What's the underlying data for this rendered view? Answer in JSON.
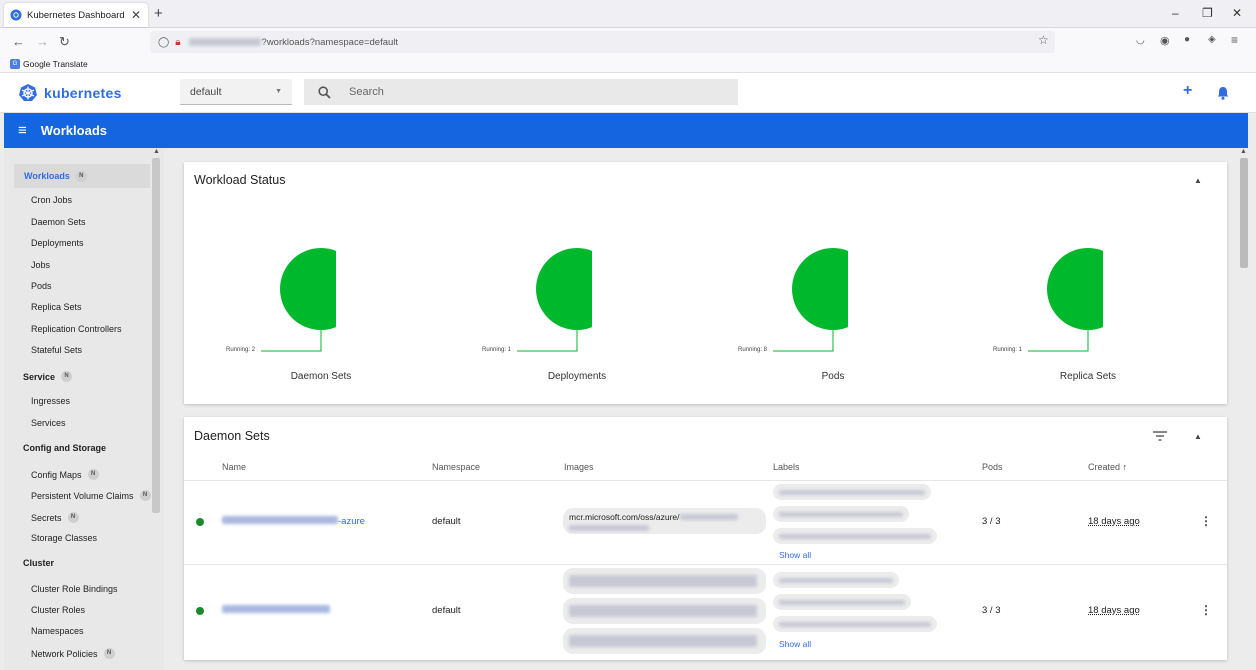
{
  "browser": {
    "tab_title": "Kubernetes Dashboard",
    "url_suffix": "?workloads?namespace=default",
    "bookmark": "Google Translate",
    "minimize": "–",
    "maximize": "❐",
    "close": "✕"
  },
  "header": {
    "logo_text": "kubernetes",
    "namespace": "default",
    "search_placeholder": "Search"
  },
  "bluebar": {
    "title": "Workloads"
  },
  "sidebar": {
    "items": [
      {
        "label": "Workloads",
        "badge": "N",
        "kind": "head",
        "active": true
      },
      {
        "label": "Cron Jobs",
        "kind": "sub"
      },
      {
        "label": "Daemon Sets",
        "kind": "sub"
      },
      {
        "label": "Deployments",
        "kind": "sub"
      },
      {
        "label": "Jobs",
        "kind": "sub"
      },
      {
        "label": "Pods",
        "kind": "sub"
      },
      {
        "label": "Replica Sets",
        "kind": "sub"
      },
      {
        "label": "Replication Controllers",
        "kind": "sub"
      },
      {
        "label": "Stateful Sets",
        "kind": "sub"
      },
      {
        "label": "Service",
        "badge": "N",
        "kind": "head"
      },
      {
        "label": "Ingresses",
        "kind": "sub"
      },
      {
        "label": "Services",
        "kind": "sub"
      },
      {
        "label": "Config and Storage",
        "kind": "head"
      },
      {
        "label": "Config Maps",
        "badge": "N",
        "kind": "sub"
      },
      {
        "label": "Persistent Volume Claims",
        "badge": "N",
        "kind": "sub"
      },
      {
        "label": "Secrets",
        "badge": "N",
        "kind": "sub"
      },
      {
        "label": "Storage Classes",
        "kind": "sub"
      },
      {
        "label": "Cluster",
        "kind": "head"
      },
      {
        "label": "Cluster Role Bindings",
        "kind": "sub"
      },
      {
        "label": "Cluster Roles",
        "kind": "sub"
      },
      {
        "label": "Namespaces",
        "kind": "sub"
      },
      {
        "label": "Network Policies",
        "badge": "N",
        "kind": "sub"
      }
    ]
  },
  "workload_status": {
    "title": "Workload Status",
    "running_color": "#00b82b",
    "charts": [
      {
        "name": "Daemon Sets",
        "running_label": "Running: 2"
      },
      {
        "name": "Deployments",
        "running_label": "Running: 1"
      },
      {
        "name": "Pods",
        "running_label": "Running: 8"
      },
      {
        "name": "Replica Sets",
        "running_label": "Running: 1"
      }
    ]
  },
  "daemon_sets": {
    "title": "Daemon Sets",
    "columns": {
      "name": "Name",
      "namespace": "Namespace",
      "images": "Images",
      "labels": "Labels",
      "pods": "Pods",
      "created": "Created"
    },
    "show_all": "Show all",
    "rows": [
      {
        "name_suffix": "-azure",
        "namespace": "default",
        "image_prefix": "mcr.microsoft.com/oss/azure/",
        "pods": "3 / 3",
        "created": "18 days ago"
      },
      {
        "name_suffix": "",
        "namespace": "default",
        "image_prefix": "",
        "pods": "3 / 3",
        "created": "18 days ago"
      }
    ]
  }
}
